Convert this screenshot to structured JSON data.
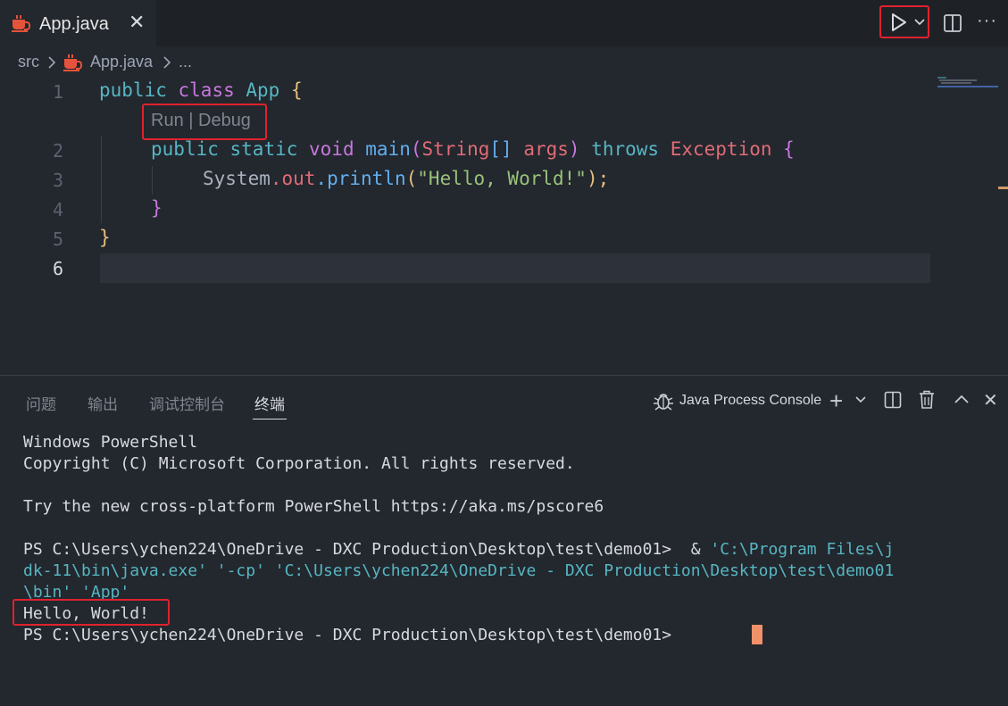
{
  "tab": {
    "title": "App.java",
    "close": "✕"
  },
  "toolbar": {
    "more": "···"
  },
  "breadcrumb": {
    "folder": "src",
    "file": "App.java",
    "more": "..."
  },
  "editor": {
    "line_numbers": [
      "1",
      "2",
      "3",
      "4",
      "5",
      "6"
    ],
    "codelens": "Run | Debug",
    "line1": {
      "public": "public",
      "class": "class",
      "name": "App",
      "brace": "{"
    },
    "line2": {
      "public": "public",
      "static": "static",
      "void": "void",
      "main": "main",
      "lparen": "(",
      "type": "String",
      "arr": "[]",
      "args": "args",
      "rparen": ")",
      "throws": "throws",
      "exception": "Exception",
      "brace": "{"
    },
    "line3": {
      "system": "System",
      "dot1": ".",
      "out": "out",
      "dot2": ".",
      "println": "println",
      "lparen": "(",
      "str": "\"Hello, World!\"",
      "end": ");"
    },
    "line4": {
      "brace": "}"
    },
    "line5": {
      "brace": "}"
    }
  },
  "panel": {
    "tabs": [
      "问题",
      "输出",
      "调试控制台",
      "终端"
    ],
    "active_tab": "终端",
    "console_label": "Java Process Console",
    "plus": "+",
    "close": "✕"
  },
  "terminal": {
    "line1": "Windows PowerShell",
    "line2": "Copyright (C) Microsoft Corporation. All rights reserved.",
    "line3": "Try the new cross-platform PowerShell https://aka.ms/pscore6",
    "line4_prompt": "PS C:\\Users\\ychen224\\OneDrive - DXC Production\\Desktop\\test\\demo01>  & ",
    "line4_cmd": "'C:\\Program Files\\j",
    "line5": "dk-11\\bin\\java.exe' '-cp' 'C:\\Users\\ychen224\\OneDrive - DXC Production\\Desktop\\test\\demo01",
    "line6": "\\bin' 'App'",
    "line7": "Hello, World!",
    "line8": "PS C:\\Users\\ychen224\\OneDrive - DXC Production\\Desktop\\test\\demo01> "
  },
  "colors": {
    "highlight": "#e0222e",
    "cursor": "#f0916a",
    "java_icon": "#e5533b"
  }
}
